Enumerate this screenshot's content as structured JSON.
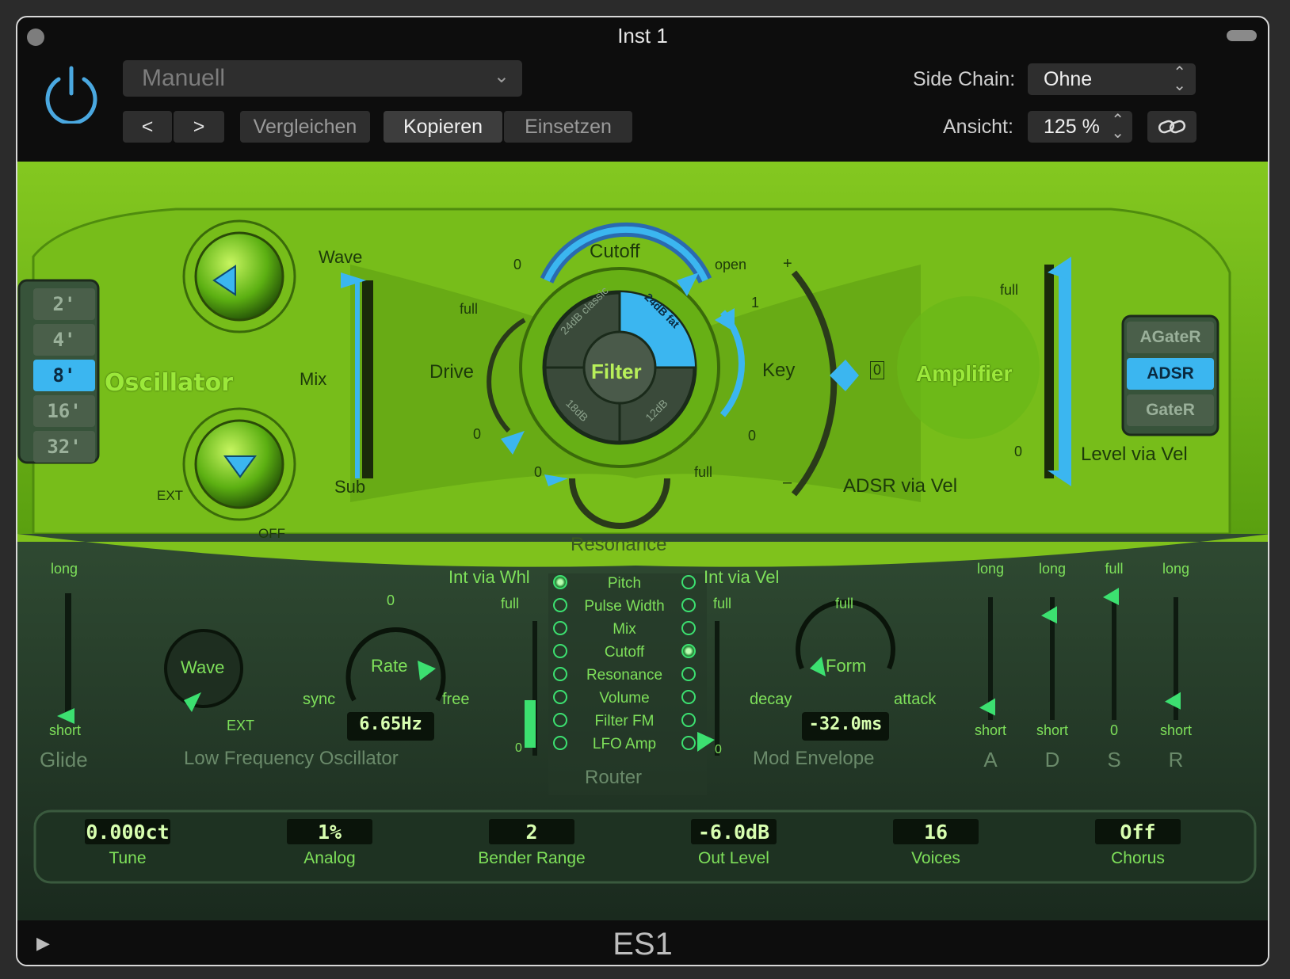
{
  "window": {
    "title": "Inst 1",
    "footer_title": "ES1"
  },
  "header": {
    "preset": "Manuell",
    "prev_label": "<",
    "next_label": ">",
    "compare_label": "Vergleichen",
    "copy_label": "Kopieren",
    "paste_label": "Einsetzen",
    "side_chain_label": "Side Chain:",
    "side_chain_value": "Ohne",
    "view_label": "Ansicht:",
    "view_value": "125 %"
  },
  "oscillator": {
    "title": "Oscillator",
    "octaves": [
      "2'",
      "4'",
      "8'",
      "16'",
      "32'"
    ],
    "selected_octave": "8'",
    "wave_label": "Wave",
    "mix_label": "Mix",
    "sub_label": "Sub",
    "ext_label": "EXT",
    "off_label": "OFF"
  },
  "filter": {
    "title": "Filter",
    "cutoff_label": "Cutoff",
    "drive_label": "Drive",
    "resonance_label": "Resonance",
    "key_label": "Key",
    "open_label": "open",
    "full_label": "full",
    "zero_label": "0",
    "one_label": "1",
    "slopes": [
      "24dB classic",
      "24dB fat",
      "18dB",
      "12dB"
    ],
    "selected_slope": "24dB fat"
  },
  "amplifier": {
    "title": "Amplifier",
    "adsr_via_vel": "ADSR via Vel",
    "level_via_vel": "Level via Vel",
    "full_label": "full",
    "zero_label": "0",
    "plus_label": "+",
    "minus_label": "–",
    "modes": [
      "AGateR",
      "ADSR",
      "GateR"
    ],
    "selected_mode": "ADSR"
  },
  "glide": {
    "title": "Glide",
    "long": "long",
    "short": "short"
  },
  "lfo": {
    "title": "Low Frequency Oscillator",
    "wave_label": "Wave",
    "rate_label": "Rate",
    "rate_value": "6.65Hz",
    "sync_label": "sync",
    "free_label": "free",
    "zero_label": "0",
    "ext_label": "EXT",
    "int_via_whl": "Int via Whl",
    "full_label": "full"
  },
  "router": {
    "title": "Router",
    "items": [
      "Pitch",
      "Pulse Width",
      "Mix",
      "Cutoff",
      "Resonance",
      "Volume",
      "Filter FM",
      "LFO Amp"
    ],
    "lfo_selected": "Pitch",
    "env_selected": "Cutoff"
  },
  "mod_envelope": {
    "title": "Mod Envelope",
    "int_via_vel": "Int via Vel",
    "full_label": "full",
    "form_label": "Form",
    "decay_label": "decay",
    "attack_label": "attack",
    "form_value": "-32.0ms",
    "zero_label": "0"
  },
  "adsr": {
    "sliders": [
      {
        "name": "A",
        "top": "long",
        "bottom": "short",
        "level": 0.1
      },
      {
        "name": "D",
        "top": "long",
        "bottom": "short",
        "level": 0.85
      },
      {
        "name": "S",
        "top": "full",
        "bottom": "0",
        "level": 1.0
      },
      {
        "name": "R",
        "top": "long",
        "bottom": "short",
        "level": 0.15
      }
    ]
  },
  "global": {
    "params": [
      {
        "value": "0.000ct",
        "label": "Tune"
      },
      {
        "value": "1%",
        "label": "Analog"
      },
      {
        "value": "2",
        "label": "Bender Range"
      },
      {
        "value": "-6.0dB",
        "label": "Out Level"
      },
      {
        "value": "16",
        "label": "Voices"
      },
      {
        "value": "Off",
        "label": "Chorus"
      }
    ]
  },
  "colors": {
    "accent": "#4aa8e0",
    "panel_green": "#6cb016",
    "highlight_blue": "#3bb6f0"
  }
}
